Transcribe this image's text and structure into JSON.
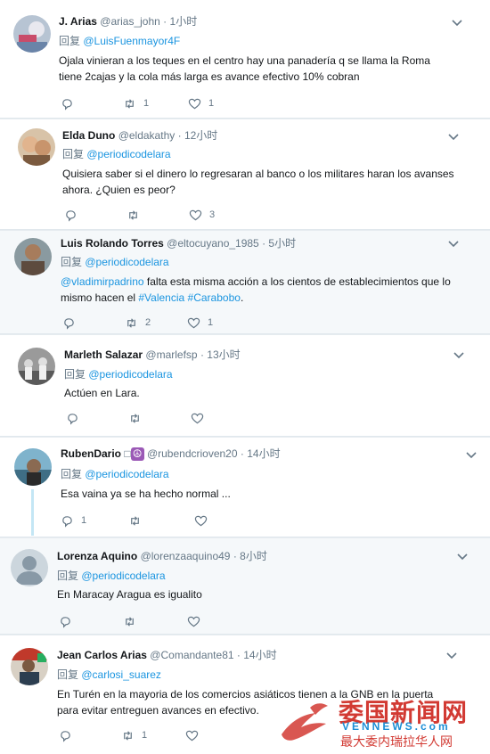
{
  "reply_prefix": "回复",
  "tweets": [
    {
      "name": "J. Arias",
      "handle": "@arias_john",
      "time": "1小时",
      "reply_to": "@LuisFuenmayor4F",
      "text_line1": "Ojala vinieran a los teques en el centro hay una panadería q se llama la Roma",
      "text_line2": "tiene 2cajas y la cola más larga es avance efectivo 10% cobran",
      "replies": "",
      "retweets": "1",
      "likes": "1",
      "avatar_color": "#8fa3b8"
    },
    {
      "name": "Elda Duno",
      "handle": "@eldakathy",
      "time": "12小时",
      "reply_to": "@periodicodelara",
      "text_line1": "Quisiera saber si el dinero lo regresaran al banco o los militares haran los avanses",
      "text_line2": "ahora. ¿Quien es peor?",
      "replies": "",
      "retweets": "",
      "likes": "3",
      "avatar_color": "#c8a27a"
    },
    {
      "name": "Luis Rolando Torres",
      "handle": "@eltocuyano_1985",
      "time": "5小时",
      "reply_to": "@periodicodelara",
      "mention": "@vladimirpadrino",
      "text_line1_rest": " falta esta misma acción a los cientos de establecimientos que lo",
      "text_line2_pre": "mismo hacen el ",
      "hashtag1": "#Valencia",
      "hashtag2": "#Carabobo",
      "text_line2_post": ".",
      "replies": "",
      "retweets": "2",
      "likes": "1",
      "avatar_color": "#6b5a4c"
    },
    {
      "name": "Marleth Salazar",
      "handle": "@marlefsp",
      "time": "13小时",
      "reply_to": "@periodicodelara",
      "text_line1": "Actúen en Lara.",
      "replies": "",
      "retweets": "",
      "likes": "",
      "avatar_color": "#7a7a7a"
    },
    {
      "name": "RubenDario",
      "name_badge": "☮",
      "handle": "@rubendcrioven20",
      "time": "14小时",
      "reply_to": "@periodicodelara",
      "text_line1": "Esa vaina ya se ha hecho normal ...",
      "replies": "1",
      "retweets": "",
      "likes": "",
      "avatar_color": "#5b8fa8"
    },
    {
      "name": "Lorenza Aquino",
      "handle": "@lorenzaaquino49",
      "time": "8小时",
      "reply_to": "@periodicodelara",
      "text_line1": "En Maracay Aragua es igualito",
      "replies": "",
      "retweets": "",
      "likes": "",
      "avatar_color": "#ccd6dd"
    },
    {
      "name": "Jean Carlos Arias",
      "handle": "@Comandante81",
      "time": "14小时",
      "reply_to": "@carlosi_suarez",
      "text_line1": "En Turén en la mayoria de los comercios asiáticos tienen a la GNB en la puerta",
      "text_line2": "para evitar entreguen avances en efectivo.",
      "replies": "",
      "retweets": "1",
      "likes": "",
      "avatar_color": "#b84a3a"
    }
  ],
  "watermark": {
    "title": "委国新闻网",
    "url": "VENNEWS.com",
    "subtitle": "最大委内瑞拉华人网"
  }
}
